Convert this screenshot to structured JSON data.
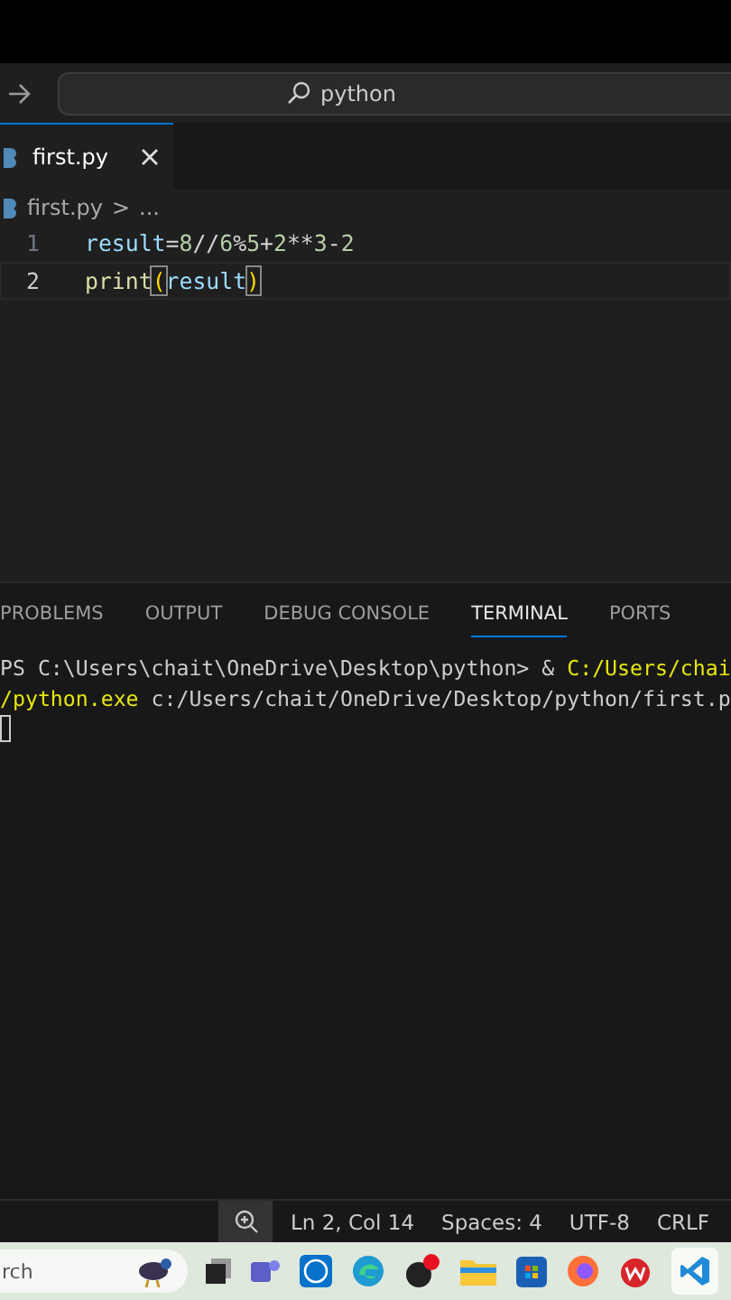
{
  "title_bar": {
    "search": "python"
  },
  "tabs": [
    {
      "label": "first.py",
      "selected": true
    }
  ],
  "breadcrumb": {
    "file": "first.py",
    "separator": ">",
    "rest": "..."
  },
  "code_lines": [
    {
      "number": "1",
      "active": false,
      "tokens": [
        {
          "text": "result",
          "kind": "variable"
        },
        {
          "text": "=",
          "kind": "operator"
        },
        {
          "text": "8",
          "kind": "number"
        },
        {
          "text": "//",
          "kind": "operator"
        },
        {
          "text": "6",
          "kind": "number"
        },
        {
          "text": "%",
          "kind": "operator"
        },
        {
          "text": "5",
          "kind": "number"
        },
        {
          "text": "+",
          "kind": "operator"
        },
        {
          "text": "2",
          "kind": "number"
        },
        {
          "text": "**",
          "kind": "operator"
        },
        {
          "text": "3",
          "kind": "number"
        },
        {
          "text": "-",
          "kind": "operator"
        },
        {
          "text": "2",
          "kind": "number"
        }
      ]
    },
    {
      "number": "2",
      "active": true,
      "tokens": [
        {
          "text": "print",
          "kind": "function"
        },
        {
          "text": "(",
          "kind": "bracket"
        },
        {
          "text": "result",
          "kind": "variable"
        },
        {
          "text": ")",
          "kind": "bracket"
        }
      ]
    }
  ],
  "panel_tabs": [
    {
      "label": "PROBLEMS",
      "selected": false
    },
    {
      "label": "OUTPUT",
      "selected": false
    },
    {
      "label": "DEBUG CONSOLE",
      "selected": false
    },
    {
      "label": "TERMINAL",
      "selected": true
    },
    {
      "label": "PORTS",
      "selected": false
    }
  ],
  "terminal_lines": [
    [
      {
        "text": "PS C:\\Users\\chait\\OneDrive\\Desktop\\python> & ",
        "kind": "plain"
      },
      {
        "text": "C:/Users/chai",
        "kind": "path"
      }
    ],
    [
      {
        "text": "/python.exe",
        "kind": "path"
      },
      {
        "text": " c:/Users/chait/OneDrive/Desktop/python/first.p",
        "kind": "plain"
      }
    ]
  ],
  "status_bar": [
    "Ln 2, Col 14",
    "Spaces: 4",
    "UTF-8",
    "CRLF"
  ],
  "taskbar": {
    "search": "rch"
  }
}
